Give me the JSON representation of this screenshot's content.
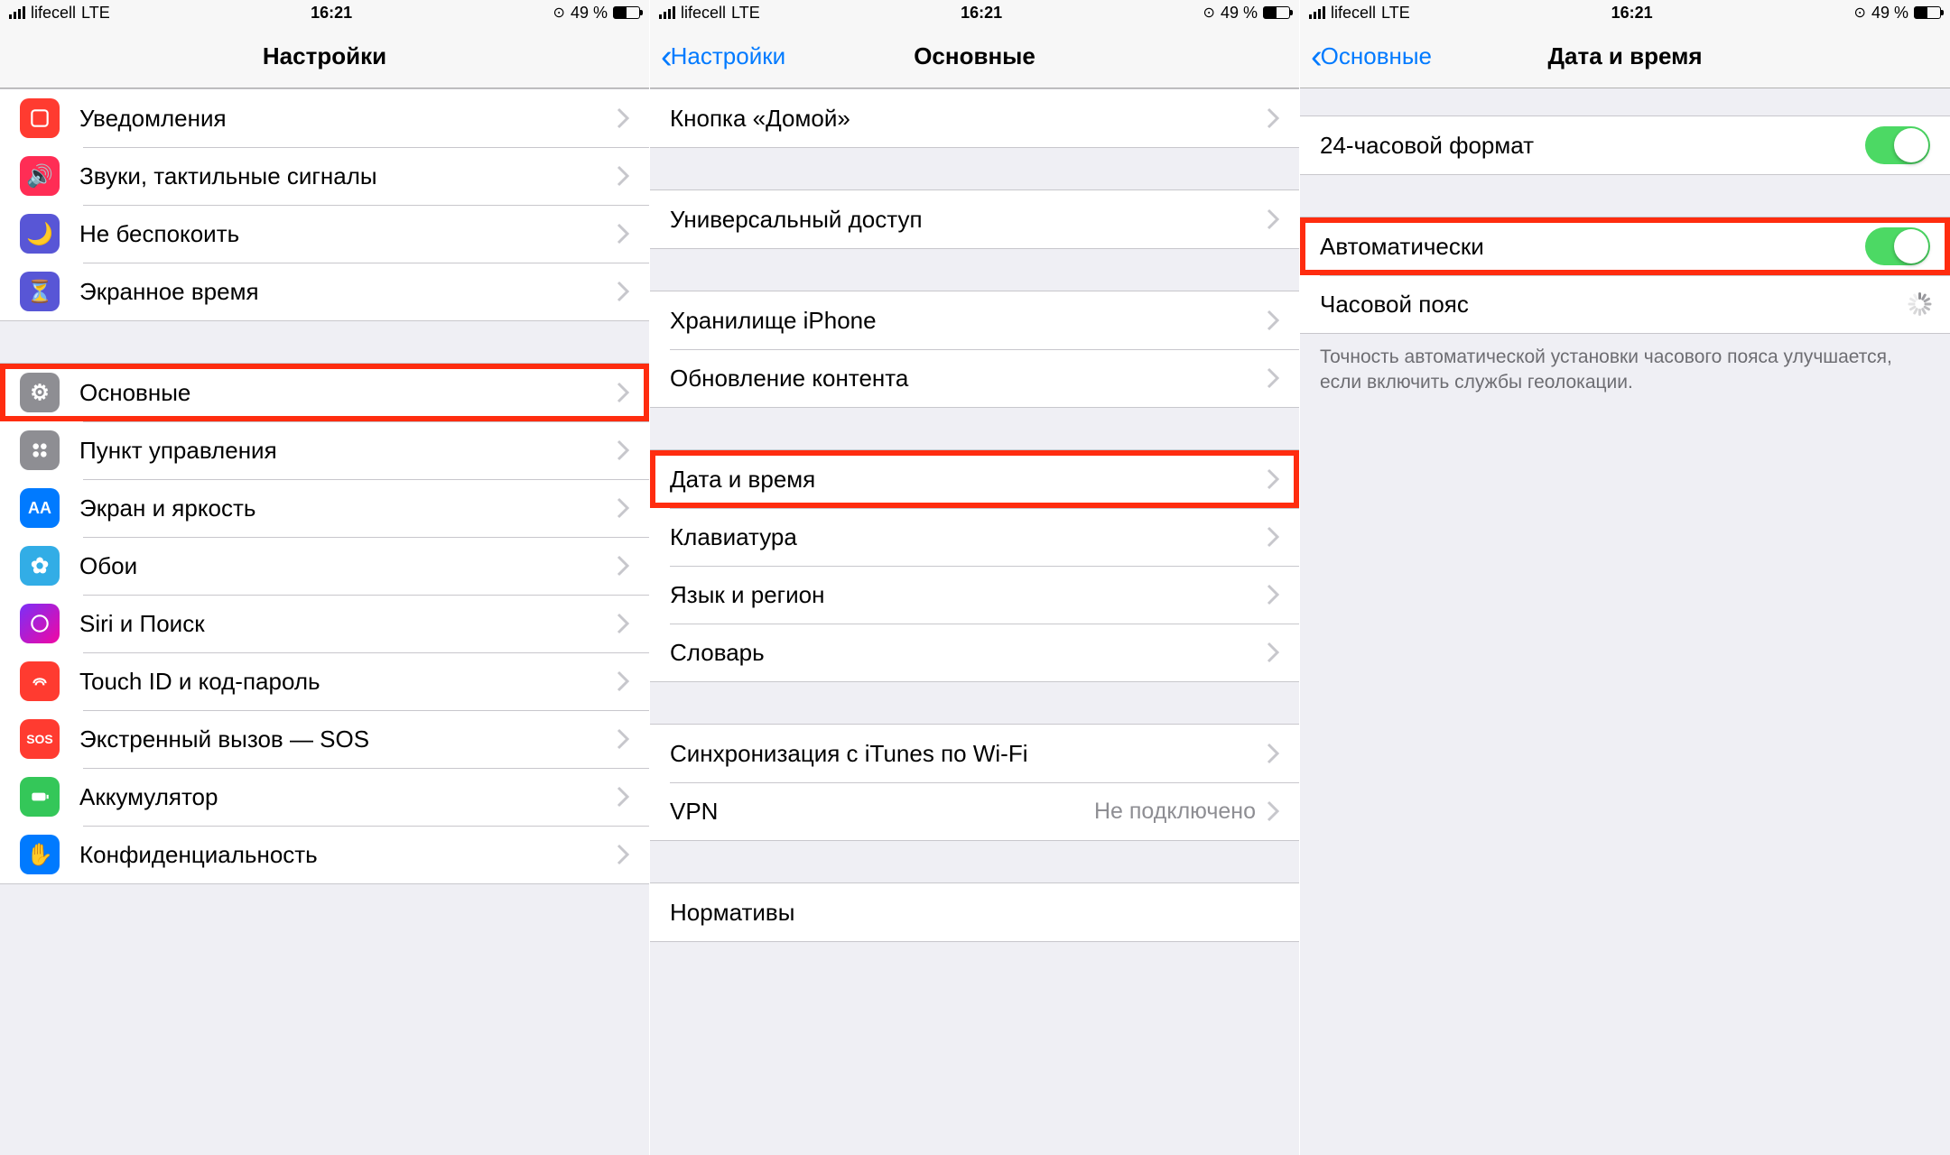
{
  "status": {
    "carrier": "lifecell",
    "network": "LTE",
    "time": "16:21",
    "battery_pct": "49 %"
  },
  "screen1": {
    "title": "Настройки",
    "items": [
      {
        "label": "Уведомления"
      },
      {
        "label": "Звуки, тактильные сигналы"
      },
      {
        "label": "Не беспокоить"
      },
      {
        "label": "Экранное время"
      },
      {
        "label": "Основные",
        "highlight": true
      },
      {
        "label": "Пункт управления"
      },
      {
        "label": "Экран и яркость"
      },
      {
        "label": "Обои"
      },
      {
        "label": "Siri и Поиск"
      },
      {
        "label": "Touch ID и код-пароль"
      },
      {
        "label": "Экстренный вызов — SOS"
      },
      {
        "label": "Аккумулятор"
      },
      {
        "label": "Конфиденциальность"
      }
    ]
  },
  "screen2": {
    "back": "Настройки",
    "title": "Основные",
    "group_a": [
      {
        "label": "Кнопка «Домой»"
      }
    ],
    "group_b": [
      {
        "label": "Универсальный доступ"
      }
    ],
    "group_c": [
      {
        "label": "Хранилище iPhone"
      },
      {
        "label": "Обновление контента"
      }
    ],
    "group_d": [
      {
        "label": "Дата и время",
        "highlight": true
      },
      {
        "label": "Клавиатура"
      },
      {
        "label": "Язык и регион"
      },
      {
        "label": "Словарь"
      }
    ],
    "group_e": [
      {
        "label": "Синхронизация с iTunes по Wi-Fi"
      },
      {
        "label": "VPN",
        "value": "Не подключено"
      }
    ],
    "group_f": [
      {
        "label": "Нормативы"
      }
    ]
  },
  "screen3": {
    "back": "Основные",
    "title": "Дата и время",
    "row_24h": "24-часовой формат",
    "row_auto": "Автоматически",
    "row_tz": "Часовой пояс",
    "note": "Точность автоматической установки часового пояса улучшается, если включить службы геолокации."
  }
}
